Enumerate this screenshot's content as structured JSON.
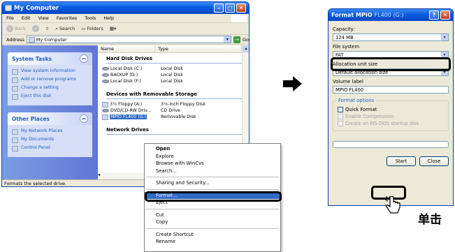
{
  "my_computer": {
    "title": "My Computer",
    "menu": [
      "File",
      "Edit",
      "View",
      "Favorites",
      "Tools",
      "Help"
    ],
    "toolbar": {
      "back": "Back",
      "search": "Search",
      "folders": "Folders"
    },
    "address": {
      "label": "Address",
      "value": "My Computer",
      "go": "Go"
    },
    "system_tasks": {
      "title": "System Tasks",
      "items": [
        "View system information",
        "Add or remove programs",
        "Change a setting",
        "Eject this disk"
      ]
    },
    "other_places": {
      "title": "Other Places",
      "items": [
        "My Network Places",
        "My Documents",
        "Control Panel"
      ]
    },
    "columns": {
      "name": "Name",
      "type": "Type"
    },
    "hard_drives": {
      "title": "Hard Disk Drives",
      "items": [
        {
          "name": "Local Disk (C:)",
          "type": "Local Disk"
        },
        {
          "name": "BACKUP (D:)",
          "type": "Local Disk"
        },
        {
          "name": "Local Disk (F:)",
          "type": "Local Disk"
        }
      ]
    },
    "removable": {
      "title": "Devices with Removable Storage",
      "items": [
        {
          "name": "3½ Floppy (A:)",
          "type": "3½-Inch Floppy Disk"
        },
        {
          "name": "DVD/CD-RW Driv...",
          "type": "CD Drive"
        },
        {
          "name": "MPIO FL400 (G:)",
          "type": "Removable Disk"
        }
      ]
    },
    "network": {
      "title": "Network Drives"
    },
    "status": "Formats the selected drive."
  },
  "context_menu": {
    "items": [
      "Open",
      "Explore",
      "Browse with WinCvs",
      "Search...",
      "Sharing and Security...",
      "Format...",
      "Eject",
      "Cut",
      "Copy",
      "Create Shortcut",
      "Rename"
    ]
  },
  "format_dialog": {
    "title": "Format MPIO",
    "title_suffix": "FL400 (G:)",
    "capacity_label": "Capacity:",
    "capacity": "124 MB",
    "fs_label": "File system",
    "fs": "FAT",
    "alloc_label": "Allocation unit size",
    "alloc": "Default allocation size",
    "volume_label": "Volume label",
    "volume": "MPIO FL400",
    "options_label": "Format options",
    "options": [
      {
        "label": "Quick Format",
        "enabled": true
      },
      {
        "label": "Enable Compression",
        "enabled": false
      },
      {
        "label": "Create an MS-DOS startup disk",
        "enabled": false
      }
    ],
    "start": "Start",
    "close": "Close"
  },
  "annotation": {
    "click_label": "单击"
  },
  "colors": {
    "selection": "#316ac5",
    "xp_title": "#0a5be0",
    "highlight_border": "#000000"
  }
}
